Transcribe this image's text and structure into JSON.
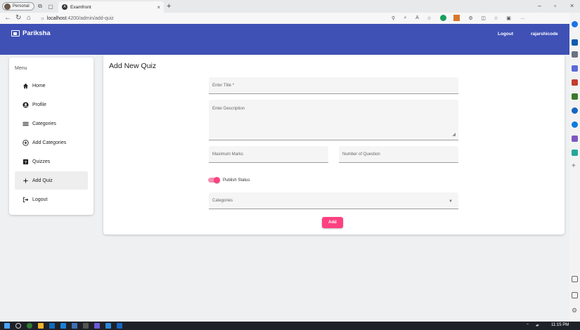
{
  "browser": {
    "profile_label": "Personal",
    "tab_title": "Examfront",
    "new_tab_symbol": "+",
    "url_host": "localhost",
    "url_path": ":4200/admin/add-quiz"
  },
  "header": {
    "brand": "Pariksha",
    "logout_label": "Logout",
    "username": "rajarshicode"
  },
  "sidebar": {
    "menu_title": "Menu",
    "items": [
      {
        "label": "Home",
        "icon": "home-icon"
      },
      {
        "label": "Profile",
        "icon": "account-circle-icon"
      },
      {
        "label": "Categories",
        "icon": "list-icon"
      },
      {
        "label": "Add Categories",
        "icon": "add-circle-icon"
      },
      {
        "label": "Quizzes",
        "icon": "quiz-icon"
      },
      {
        "label": "Add Quiz",
        "icon": "plus-icon"
      },
      {
        "label": "Logout",
        "icon": "logout-icon"
      }
    ],
    "active_item": "Add Quiz"
  },
  "form": {
    "page_title": "Add New Quiz",
    "title_placeholder": "Enter Title *",
    "description_placeholder": "Enter Description",
    "max_marks_placeholder": "Maximum Marks",
    "num_questions_placeholder": "Number of Question",
    "publish_label": "Publish Status",
    "publish_on": true,
    "categories_placeholder": "Categories",
    "submit_label": "Add"
  },
  "taskbar": {
    "time": "11:15 PM"
  },
  "colors": {
    "primary": "#3f51b5",
    "accent": "#ff4081"
  }
}
